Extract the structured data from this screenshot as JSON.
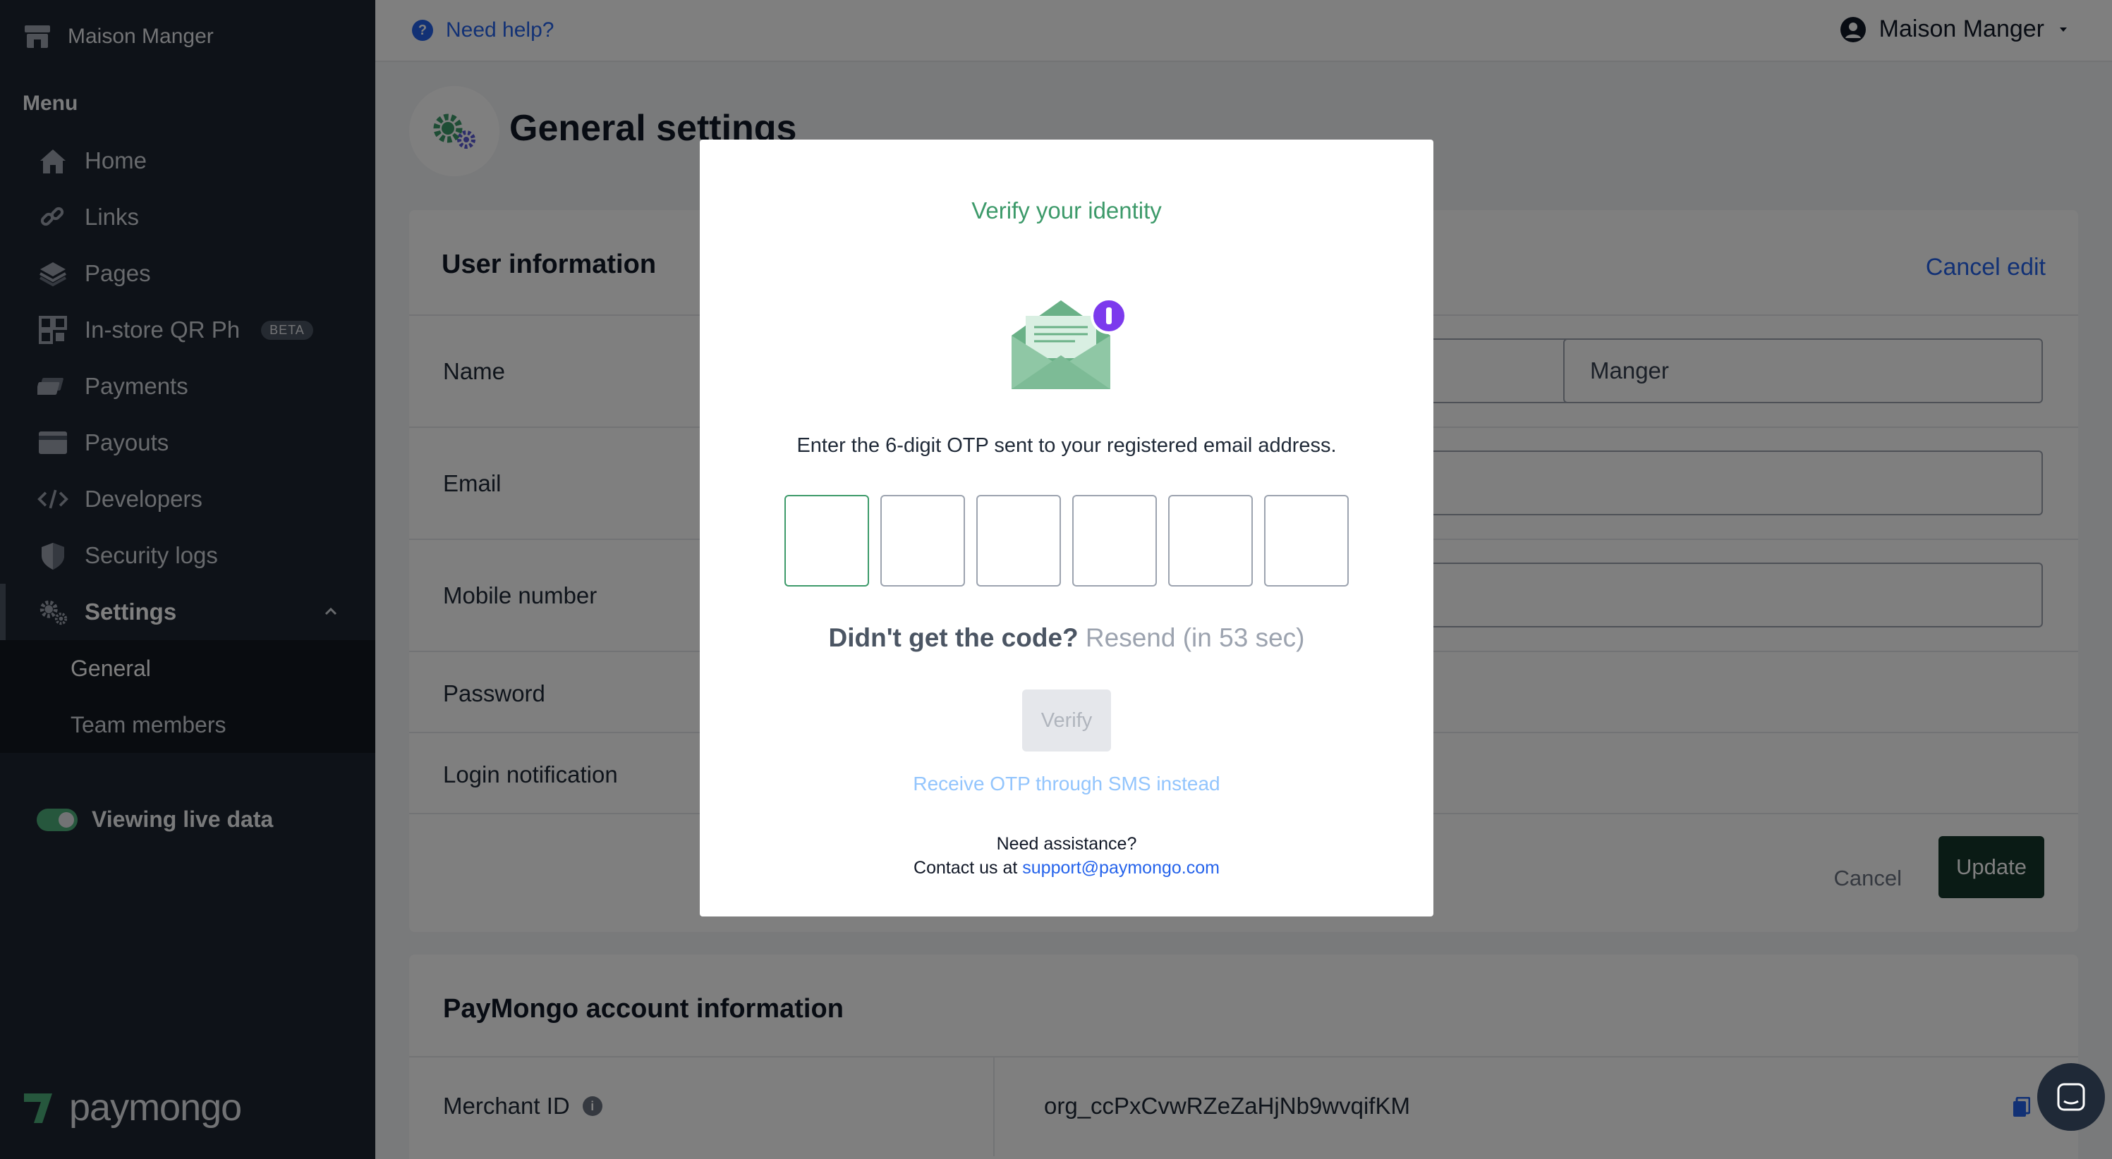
{
  "sidebar": {
    "brand": "Maison Manger",
    "menu_label": "Menu",
    "items": [
      {
        "label": "Home",
        "icon": "home-icon"
      },
      {
        "label": "Links",
        "icon": "links-icon"
      },
      {
        "label": "Pages",
        "icon": "pages-icon"
      },
      {
        "label": "In-store QR Ph",
        "icon": "qr-icon",
        "badge": "BETA"
      },
      {
        "label": "Payments",
        "icon": "payments-icon"
      },
      {
        "label": "Payouts",
        "icon": "payouts-icon"
      },
      {
        "label": "Developers",
        "icon": "code-icon"
      },
      {
        "label": "Security logs",
        "icon": "shield-icon"
      },
      {
        "label": "Settings",
        "icon": "gear-icon"
      }
    ],
    "settings_sub": [
      {
        "label": "General"
      },
      {
        "label": "Team members"
      }
    ],
    "live_label": "Viewing live data",
    "logo_text": "paymongo"
  },
  "topbar": {
    "help": "Need help?",
    "user": "Maison Manger"
  },
  "page": {
    "title": "General settings",
    "card_title": "User information",
    "cancel_edit": "Cancel edit",
    "rows": {
      "name": "Name",
      "email": "Email",
      "mobile": "Mobile number",
      "password": "Password",
      "login": "Login notification"
    },
    "last_name_value": "Manger",
    "cancel": "Cancel",
    "update": "Update",
    "account_title": "PayMongo account information",
    "merchant_label": "Merchant ID",
    "merchant_value": "org_ccPxCvwRZeZaHjNb9wvqifKM"
  },
  "modal": {
    "title": "Verify your identity",
    "instruction": "Enter the 6-digit OTP sent to your registered email address.",
    "otp_count": 6,
    "resend_question": "Didn't get the code?",
    "resend_action": "Resend (in 53 sec)",
    "verify": "Verify",
    "sms": "Receive OTP through SMS instead",
    "assist_line1": "Need assistance?",
    "assist_prefix": "Contact us at",
    "assist_email": "support@paymongo.com"
  },
  "colors": {
    "sidebar_bg": "#1d2430",
    "accent_green": "#3d9a6a",
    "link_blue": "#2563eb",
    "update_btn": "#14362b"
  }
}
